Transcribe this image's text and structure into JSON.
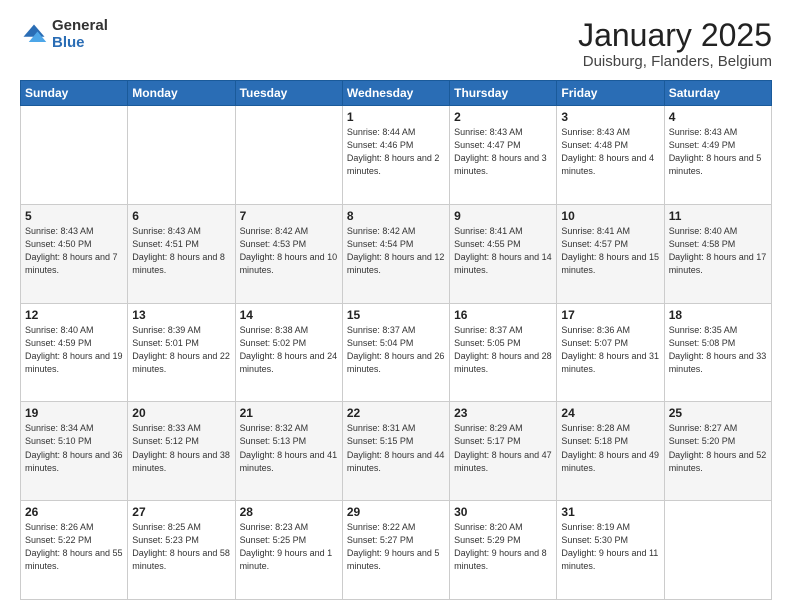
{
  "header": {
    "logo_general": "General",
    "logo_blue": "Blue",
    "title": "January 2025",
    "subtitle": "Duisburg, Flanders, Belgium"
  },
  "days_of_week": [
    "Sunday",
    "Monday",
    "Tuesday",
    "Wednesday",
    "Thursday",
    "Friday",
    "Saturday"
  ],
  "weeks": [
    [
      {
        "day": "",
        "info": ""
      },
      {
        "day": "",
        "info": ""
      },
      {
        "day": "",
        "info": ""
      },
      {
        "day": "1",
        "info": "Sunrise: 8:44 AM\nSunset: 4:46 PM\nDaylight: 8 hours and 2 minutes."
      },
      {
        "day": "2",
        "info": "Sunrise: 8:43 AM\nSunset: 4:47 PM\nDaylight: 8 hours and 3 minutes."
      },
      {
        "day": "3",
        "info": "Sunrise: 8:43 AM\nSunset: 4:48 PM\nDaylight: 8 hours and 4 minutes."
      },
      {
        "day": "4",
        "info": "Sunrise: 8:43 AM\nSunset: 4:49 PM\nDaylight: 8 hours and 5 minutes."
      }
    ],
    [
      {
        "day": "5",
        "info": "Sunrise: 8:43 AM\nSunset: 4:50 PM\nDaylight: 8 hours and 7 minutes."
      },
      {
        "day": "6",
        "info": "Sunrise: 8:43 AM\nSunset: 4:51 PM\nDaylight: 8 hours and 8 minutes."
      },
      {
        "day": "7",
        "info": "Sunrise: 8:42 AM\nSunset: 4:53 PM\nDaylight: 8 hours and 10 minutes."
      },
      {
        "day": "8",
        "info": "Sunrise: 8:42 AM\nSunset: 4:54 PM\nDaylight: 8 hours and 12 minutes."
      },
      {
        "day": "9",
        "info": "Sunrise: 8:41 AM\nSunset: 4:55 PM\nDaylight: 8 hours and 14 minutes."
      },
      {
        "day": "10",
        "info": "Sunrise: 8:41 AM\nSunset: 4:57 PM\nDaylight: 8 hours and 15 minutes."
      },
      {
        "day": "11",
        "info": "Sunrise: 8:40 AM\nSunset: 4:58 PM\nDaylight: 8 hours and 17 minutes."
      }
    ],
    [
      {
        "day": "12",
        "info": "Sunrise: 8:40 AM\nSunset: 4:59 PM\nDaylight: 8 hours and 19 minutes."
      },
      {
        "day": "13",
        "info": "Sunrise: 8:39 AM\nSunset: 5:01 PM\nDaylight: 8 hours and 22 minutes."
      },
      {
        "day": "14",
        "info": "Sunrise: 8:38 AM\nSunset: 5:02 PM\nDaylight: 8 hours and 24 minutes."
      },
      {
        "day": "15",
        "info": "Sunrise: 8:37 AM\nSunset: 5:04 PM\nDaylight: 8 hours and 26 minutes."
      },
      {
        "day": "16",
        "info": "Sunrise: 8:37 AM\nSunset: 5:05 PM\nDaylight: 8 hours and 28 minutes."
      },
      {
        "day": "17",
        "info": "Sunrise: 8:36 AM\nSunset: 5:07 PM\nDaylight: 8 hours and 31 minutes."
      },
      {
        "day": "18",
        "info": "Sunrise: 8:35 AM\nSunset: 5:08 PM\nDaylight: 8 hours and 33 minutes."
      }
    ],
    [
      {
        "day": "19",
        "info": "Sunrise: 8:34 AM\nSunset: 5:10 PM\nDaylight: 8 hours and 36 minutes."
      },
      {
        "day": "20",
        "info": "Sunrise: 8:33 AM\nSunset: 5:12 PM\nDaylight: 8 hours and 38 minutes."
      },
      {
        "day": "21",
        "info": "Sunrise: 8:32 AM\nSunset: 5:13 PM\nDaylight: 8 hours and 41 minutes."
      },
      {
        "day": "22",
        "info": "Sunrise: 8:31 AM\nSunset: 5:15 PM\nDaylight: 8 hours and 44 minutes."
      },
      {
        "day": "23",
        "info": "Sunrise: 8:29 AM\nSunset: 5:17 PM\nDaylight: 8 hours and 47 minutes."
      },
      {
        "day": "24",
        "info": "Sunrise: 8:28 AM\nSunset: 5:18 PM\nDaylight: 8 hours and 49 minutes."
      },
      {
        "day": "25",
        "info": "Sunrise: 8:27 AM\nSunset: 5:20 PM\nDaylight: 8 hours and 52 minutes."
      }
    ],
    [
      {
        "day": "26",
        "info": "Sunrise: 8:26 AM\nSunset: 5:22 PM\nDaylight: 8 hours and 55 minutes."
      },
      {
        "day": "27",
        "info": "Sunrise: 8:25 AM\nSunset: 5:23 PM\nDaylight: 8 hours and 58 minutes."
      },
      {
        "day": "28",
        "info": "Sunrise: 8:23 AM\nSunset: 5:25 PM\nDaylight: 9 hours and 1 minute."
      },
      {
        "day": "29",
        "info": "Sunrise: 8:22 AM\nSunset: 5:27 PM\nDaylight: 9 hours and 5 minutes."
      },
      {
        "day": "30",
        "info": "Sunrise: 8:20 AM\nSunset: 5:29 PM\nDaylight: 9 hours and 8 minutes."
      },
      {
        "day": "31",
        "info": "Sunrise: 8:19 AM\nSunset: 5:30 PM\nDaylight: 9 hours and 11 minutes."
      },
      {
        "day": "",
        "info": ""
      }
    ]
  ]
}
